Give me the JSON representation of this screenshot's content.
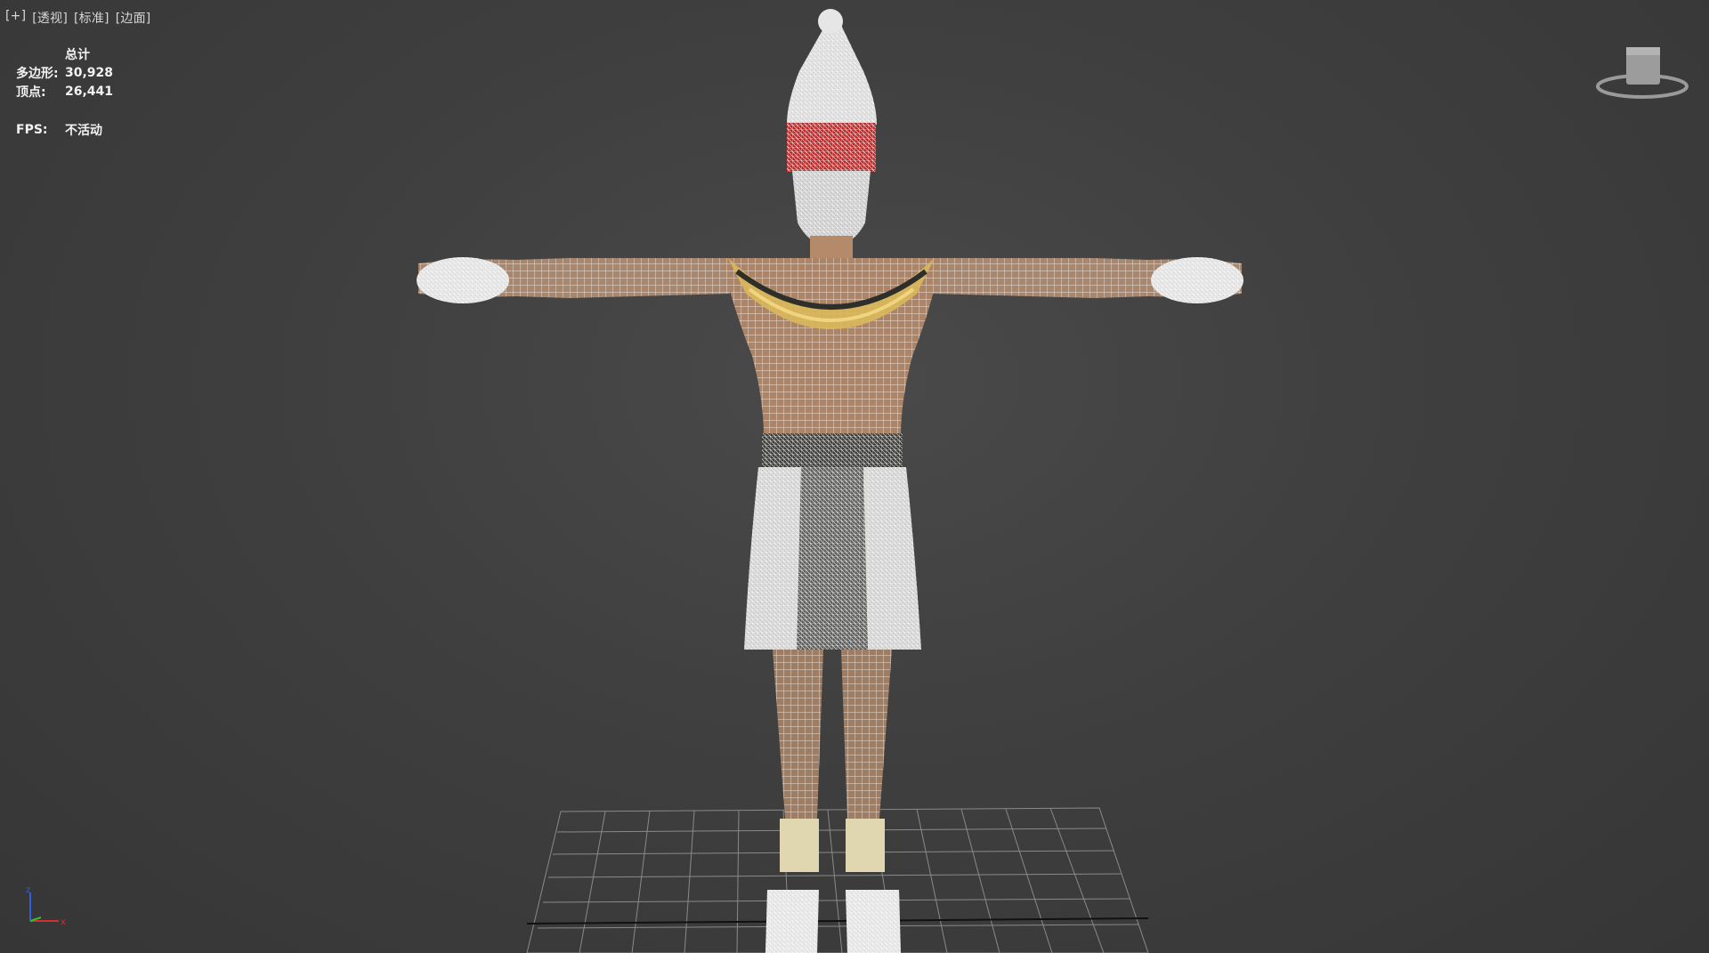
{
  "viewport": {
    "labels": [
      "[+]",
      "[透视]",
      "[标准]",
      "[边面]"
    ]
  },
  "stats": {
    "header": "总计",
    "rows": [
      {
        "label": "多边形:",
        "value": "30,928"
      },
      {
        "label": "顶点:",
        "value": "26,441"
      }
    ],
    "fps": {
      "label": "FPS:",
      "value": "不活动"
    }
  },
  "viewcube": {
    "icon": "viewcube-icon"
  },
  "axis": {
    "x": "x",
    "z": "z",
    "colors": {
      "x": "#d23030",
      "y": "#30c030",
      "z": "#3060e0"
    }
  },
  "colors": {
    "skin": "#b58a6a",
    "wire": "#ffffff",
    "gold": "#d9b85a",
    "red": "#c0282a",
    "dark": "#2e2e2a"
  }
}
